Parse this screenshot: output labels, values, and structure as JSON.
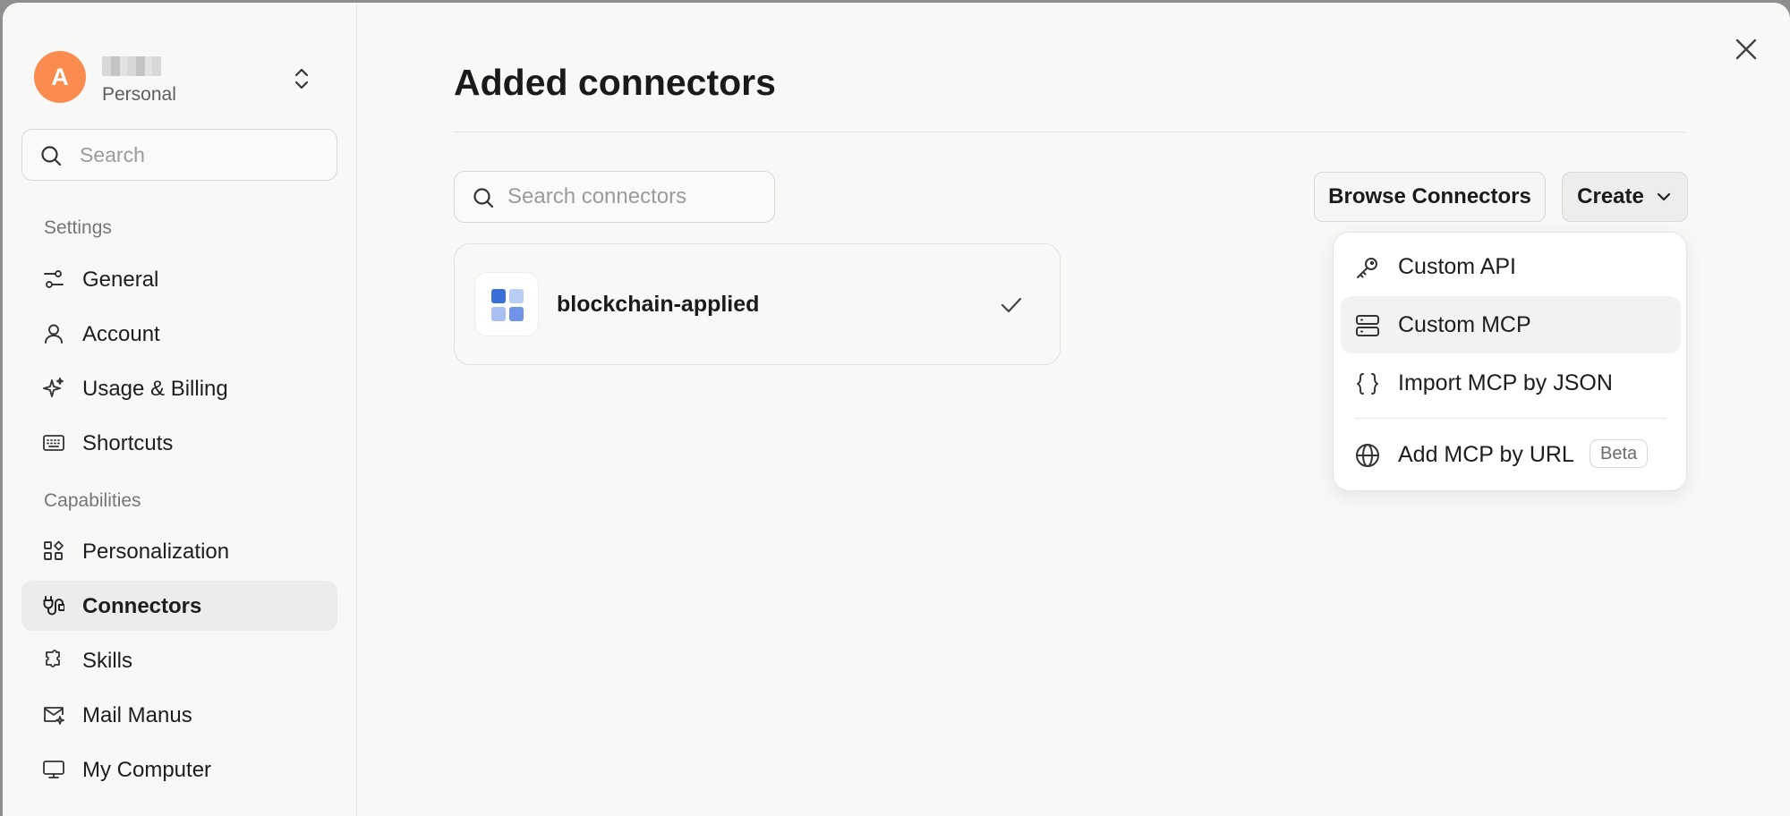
{
  "sidebar": {
    "user": {
      "avatar_initial": "A",
      "name": "",
      "plan": "Personal"
    },
    "search": {
      "placeholder": "Search"
    },
    "sections": {
      "settings": "Settings",
      "capabilities": "Capabilities"
    },
    "items": [
      {
        "id": "general",
        "label": "General",
        "icon": "sliders-icon"
      },
      {
        "id": "account",
        "label": "Account",
        "icon": "user-icon"
      },
      {
        "id": "usage-billing",
        "label": "Usage & Billing",
        "icon": "sparkle-icon"
      },
      {
        "id": "shortcuts",
        "label": "Shortcuts",
        "icon": "keyboard-icon"
      },
      {
        "id": "personalization",
        "label": "Personalization",
        "icon": "grid-icon"
      },
      {
        "id": "connectors",
        "label": "Connectors",
        "icon": "plug-icon",
        "active": true
      },
      {
        "id": "skills",
        "label": "Skills",
        "icon": "puzzle-icon"
      },
      {
        "id": "mail-manus",
        "label": "Mail Manus",
        "icon": "mail-icon"
      },
      {
        "id": "my-computer",
        "label": "My Computer",
        "icon": "monitor-icon"
      }
    ]
  },
  "main": {
    "title": "Added connectors",
    "search": {
      "placeholder": "Search connectors"
    },
    "browse_label": "Browse Connectors",
    "create_label": "Create",
    "connectors": [
      {
        "name": "blockchain-applied",
        "connected": true
      }
    ]
  },
  "create_menu": {
    "items": [
      {
        "label": "Custom API",
        "icon": "key-icon"
      },
      {
        "label": "Custom MCP",
        "icon": "server-icon",
        "hovered": true
      },
      {
        "label": "Import MCP by JSON",
        "icon": "braces-icon"
      },
      {
        "label": "Add MCP by URL",
        "icon": "globe-icon",
        "badge": "Beta"
      }
    ]
  },
  "colors": {
    "accent": "#fb8c4f",
    "background": "#f8f8f7",
    "active_item": "#ececea"
  }
}
